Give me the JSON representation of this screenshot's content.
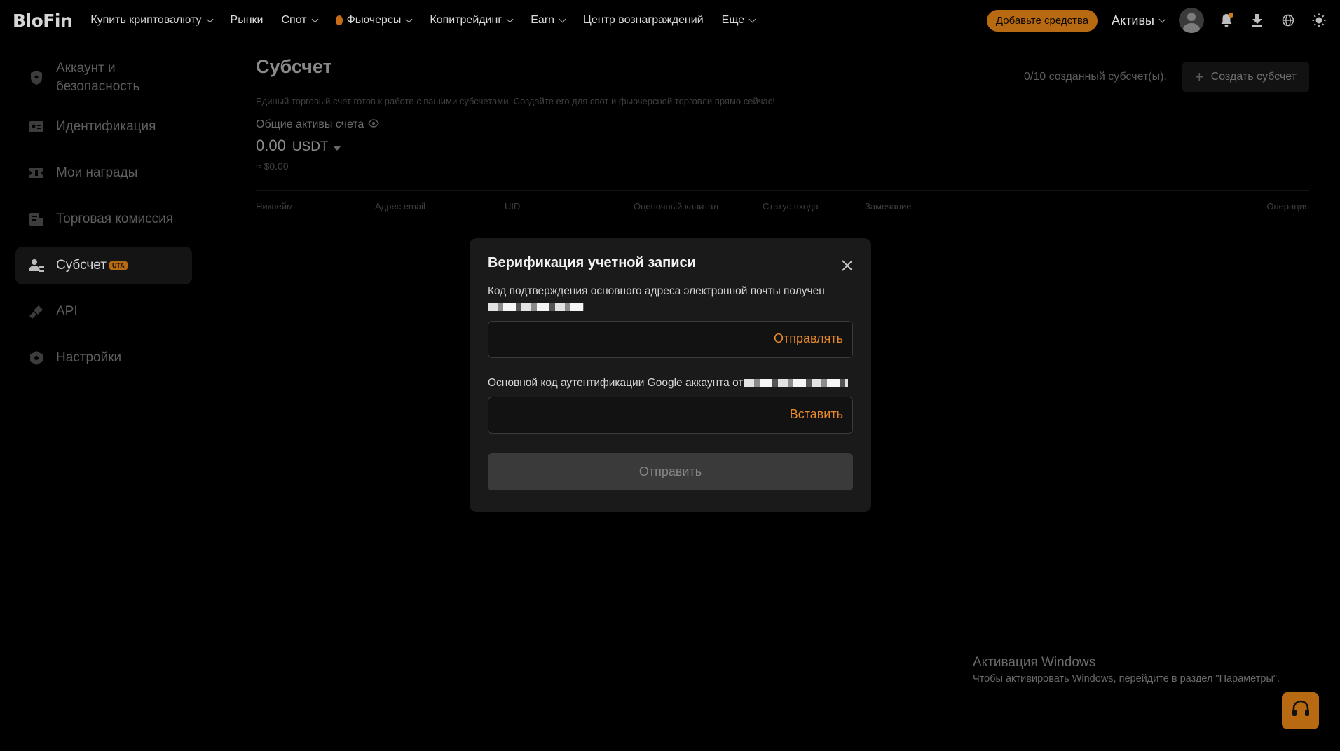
{
  "nav": {
    "logo": "BloFin",
    "items": [
      {
        "label": "Купить криптовалюту",
        "dropdown": true
      },
      {
        "label": "Рынки",
        "dropdown": false
      },
      {
        "label": "Спот",
        "dropdown": true
      },
      {
        "label": "Фьючерсы",
        "dropdown": true
      },
      {
        "label": "Копитрейдинг",
        "dropdown": true
      },
      {
        "label": "Earn",
        "dropdown": true
      },
      {
        "label": "Центр вознаграждений",
        "dropdown": false
      },
      {
        "label": "Еще",
        "dropdown": true
      }
    ],
    "deposit": "Добавьте средства",
    "assets": "Активы"
  },
  "sidebar": {
    "items": [
      {
        "label": "Аккаунт и безопасность",
        "icon": "shield-icon"
      },
      {
        "label": "Идентификация",
        "icon": "id-card-icon"
      },
      {
        "label": "Мои награды",
        "icon": "ticket-icon"
      },
      {
        "label": "Торговая комиссия",
        "icon": "fee-icon"
      },
      {
        "label": "Субсчет",
        "icon": "sub-account-icon",
        "badge": "UTA",
        "active": true
      },
      {
        "label": "API",
        "icon": "api-icon"
      },
      {
        "label": "Настройки",
        "icon": "settings-icon"
      }
    ]
  },
  "main": {
    "title": "Субсчет",
    "counter": "0/10 созданный субсчет(ы).",
    "create_label": "Создать субсчет",
    "subtitle": "Единый торговый счет готов к работе с вашими субсчетами. Создайте его для спот и фьючерсной торговли прямо сейчас!",
    "assets_label": "Общие активы счета",
    "balance_value": "0.00",
    "balance_currency": "USDT",
    "balance_usd": "≈ $0.00",
    "table_headers": [
      "Никнейм",
      "Адрес email",
      "UID",
      "Оценочный капитал",
      "Статус входа",
      "Замечание",
      "Операция"
    ]
  },
  "modal": {
    "title": "Верификация учетной записи",
    "email_label": "Код подтверждения основного адреса электронной почты получен",
    "email_input_value": "",
    "email_action": "Отправлять",
    "google_label": "Основной код аутентификации Google аккаунта от",
    "google_input_value": "",
    "google_action": "Вставить",
    "submit_label": "Отправить"
  },
  "watermark": {
    "title": "Активация Windows",
    "text": "Чтобы активировать Windows, перейдите в раздел \"Параметры\"."
  },
  "colors": {
    "accent": "#b86a12",
    "link": "#e8892a",
    "modal_bg": "#1a1a1a"
  }
}
